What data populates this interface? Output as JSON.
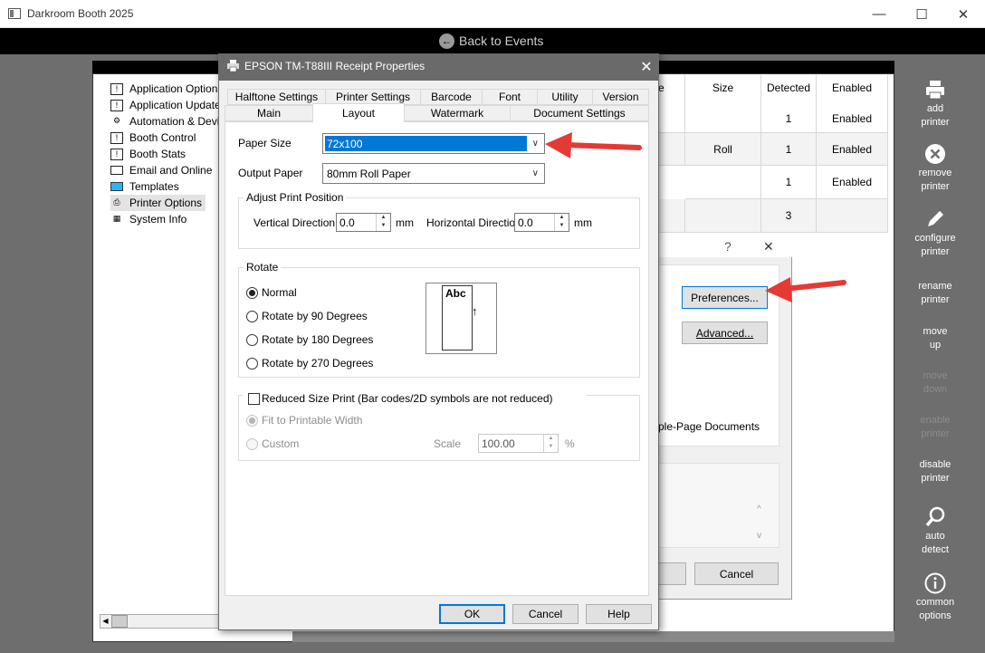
{
  "window": {
    "title": "Darkroom Booth 2025",
    "minimize_glyph": "—",
    "maximize_glyph": "☐",
    "close_glyph": "✕",
    "back_label": "Back to Events"
  },
  "toolbar": [
    {
      "line1": "add",
      "line2": "printer",
      "icon": "printer-icon",
      "enabled": true
    },
    {
      "line1": "remove",
      "line2": "printer",
      "icon": "remove-icon",
      "enabled": true
    },
    {
      "line1": "configure",
      "line2": "printer",
      "icon": "pencil-icon",
      "enabled": true
    },
    {
      "line1": "rename",
      "line2": "printer",
      "icon": "",
      "enabled": true
    },
    {
      "line1": "move",
      "line2": "up",
      "icon": "",
      "enabled": true
    },
    {
      "line1": "move",
      "line2": "down",
      "icon": "",
      "enabled": false
    },
    {
      "line1": "enable",
      "line2": "printer",
      "icon": "",
      "enabled": false
    },
    {
      "line1": "disable",
      "line2": "printer",
      "icon": "",
      "enabled": true
    },
    {
      "line1": "auto",
      "line2": "detect",
      "icon": "magnifier-icon",
      "enabled": true
    },
    {
      "line1": "common",
      "line2": "options",
      "icon": "info-icon",
      "enabled": true
    }
  ],
  "tree": [
    {
      "label": "Application Options",
      "icon": "app-options-icon"
    },
    {
      "label": "Application Updates",
      "icon": "updates-icon"
    },
    {
      "label": "Automation & Devices",
      "icon": "automation-icon"
    },
    {
      "label": "Booth Control",
      "icon": "booth-control-icon"
    },
    {
      "label": "Booth Stats",
      "icon": "booth-stats-icon"
    },
    {
      "label": "Email and Online",
      "icon": "email-icon"
    },
    {
      "label": "Templates",
      "icon": "templates-icon"
    },
    {
      "label": "Printer Options",
      "icon": "printer-options-icon"
    },
    {
      "label": "System Info",
      "icon": "system-info-icon"
    }
  ],
  "table": {
    "headers": {
      "col_e": "e",
      "size": "Size",
      "detected": "Detected",
      "enabled": "Enabled"
    },
    "rows": [
      {
        "size": "",
        "detected": "1",
        "enabled": "Enabled"
      },
      {
        "size": "Roll",
        "detected": "1",
        "enabled": "Enabled"
      },
      {
        "size": "",
        "detected": "1",
        "enabled": "Enabled"
      },
      {
        "size": "",
        "detected": "3",
        "enabled": ""
      }
    ]
  },
  "bg_dialog": {
    "help_glyph": "?",
    "close_glyph": "✕",
    "preferences_label": "Preferences...",
    "advanced_label": "Advanced...",
    "multi_page_text": "ple-Page Documents",
    "cancel_label": "Cancel",
    "scroll_up": "^",
    "scroll_down": "v"
  },
  "dialog": {
    "title": "EPSON TM-T88III Receipt Properties",
    "close_glyph": "✕",
    "tabs_row1": [
      "Halftone Settings",
      "Printer Settings",
      "Barcode",
      "Font",
      "Utility",
      "Version"
    ],
    "tabs_row2": [
      "Main",
      "Layout",
      "Watermark",
      "Document Settings"
    ],
    "active_tab": "Layout",
    "paper_size_label": "Paper Size",
    "paper_size_value": "72x100",
    "output_paper_label": "Output Paper",
    "output_paper_value": "80mm Roll Paper",
    "adjust_group": "Adjust Print Position",
    "vertical_label": "Vertical Direction",
    "vertical_value": "0.0",
    "horizontal_label": "Horizontal Direction",
    "horizontal_value": "0.0",
    "unit_mm": "mm",
    "rotate_group": "Rotate",
    "rotate_options": [
      "Normal",
      "Rotate by 90 Degrees",
      "Rotate by 180 Degrees",
      "Rotate by 270 Degrees"
    ],
    "rotate_selected": "Normal",
    "preview_text": "Abc",
    "reduced_label": "Reduced Size Print (Bar codes/2D symbols are not reduced)",
    "reduced_checked": false,
    "fit_label": "Fit to Printable Width",
    "custom_label": "Custom",
    "scale_label": "Scale",
    "scale_value": "100.00",
    "percent": "%",
    "ok_label": "OK",
    "cancel_label": "Cancel",
    "help_label": "Help"
  },
  "colors": {
    "selection": "#0078d7",
    "annotation_arrow": "#e53935",
    "background": "#6e6e6e"
  }
}
